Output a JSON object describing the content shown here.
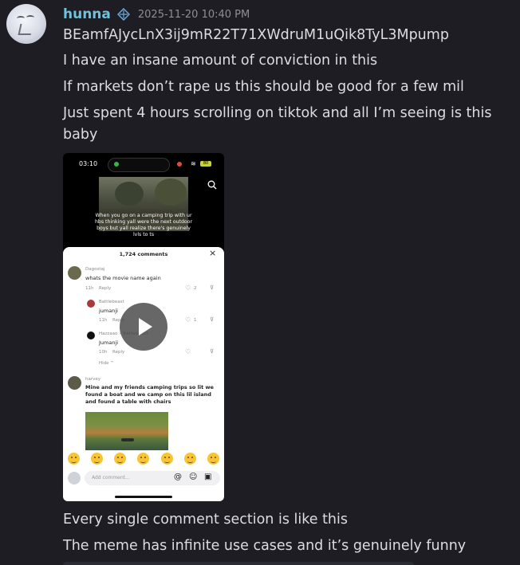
{
  "author": {
    "username": "hunna",
    "timestamp": "2025-11-20 10:40 PM",
    "badge_icon": "diamond-badge-icon",
    "username_color": "#6fc2dc"
  },
  "messages": [
    "BEamfAJycLnX3ij9mR22T71XWdruM1uQik8TyL3Mpump",
    "I have an insane amount of conviction in this",
    "If markets don’t rape us this should be good for a few mil",
    "Just spent 4 hours scrolling on tiktok and all I’m seeing is this baby"
  ],
  "video": {
    "status_time": "03:10",
    "battery": "80",
    "video_caption": "When you go on a camping trip with ur hbs thinking yall were the next outdoor boys but yall realize there's genuinely lvls to ts",
    "comments_header": "1,724 comments",
    "comments": [
      {
        "user": "Dagostaj",
        "text": "whats the movie name again",
        "age": "11h",
        "reply": "Reply",
        "likes": "2"
      },
      {
        "user": "Battlebeast",
        "text": "jumanji",
        "age": "11h",
        "reply": "Reply",
        "likes": "1"
      },
      {
        "user": "Hazzaao » Battlebeast",
        "text": "Jumanji",
        "age": "10h",
        "reply": "Reply",
        "likes": ""
      },
      {
        "user": "harvey",
        "text": "Mine and my friends camping trips so lit we found a boat and we camp on this lil island and found a table with chairs",
        "age": "",
        "reply": "",
        "likes": ""
      }
    ],
    "hide_label": "Hide ^",
    "input_placeholder": "Add comment..."
  },
  "messages_after": [
    "Every single comment section is like this",
    "The meme has infinite use cases and it’s genuinely funny"
  ]
}
